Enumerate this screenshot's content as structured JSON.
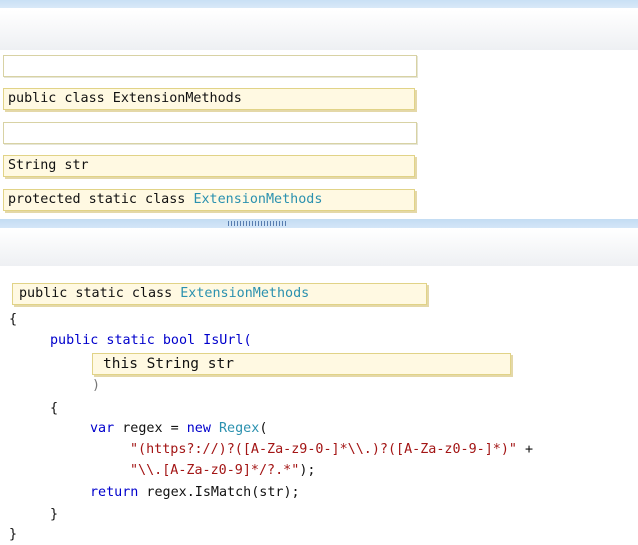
{
  "answer_area": {
    "empty_slot_1": "",
    "option_1": "public class ExtensionMethods",
    "empty_slot_2": "",
    "option_2": "String str",
    "option_3_prefix": "protected static class ",
    "option_3_type": "ExtensionMethods"
  },
  "code_area": {
    "class_tile_prefix": "public static class ",
    "class_tile_type": "ExtensionMethods",
    "open_brace": "{",
    "method_sig": "public static bool IsUrl(",
    "param_tile": "this String str",
    "close_paren": ")",
    "method_open_brace": "{",
    "var_keyword": "var",
    "regex_assign": " regex = ",
    "new_keyword": "new",
    "regex_type": "Regex",
    "regex_open": "(",
    "regex_string_1": "\"(https?://)?([A-Za-z9-0-]*\\\\.)?([A-Za-z0-9-]*)\"",
    "plus": " +",
    "regex_string_2": "\"\\\\.[A-Za-z0-9]*/?.*\"",
    "regex_close": ");",
    "return_keyword": "return",
    "return_rest": " regex.IsMatch(str);",
    "method_close_brace": "}",
    "class_close_brace": "}"
  }
}
